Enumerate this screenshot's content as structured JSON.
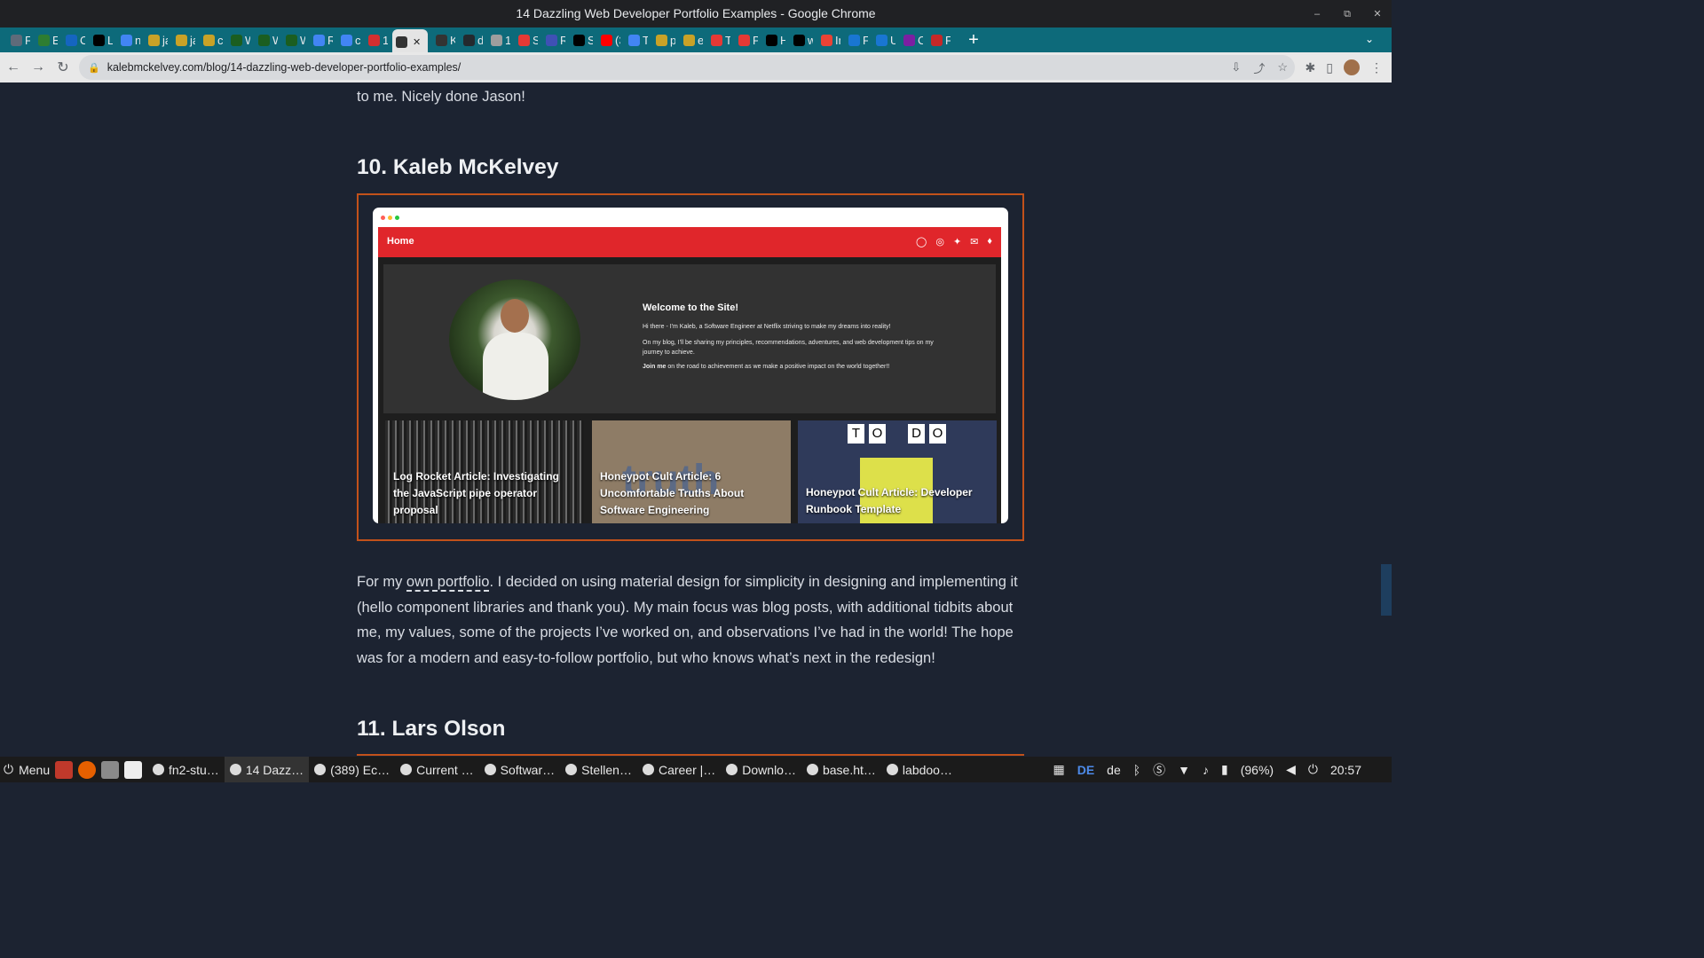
{
  "window": {
    "title": "14 Dazzling Web Developer Portfolio Examples - Google Chrome",
    "controls": [
      "–",
      "⧉",
      "✕"
    ]
  },
  "tabs": [
    {
      "label": "Fi",
      "fav_color": "#5f6b7a"
    },
    {
      "label": "Er",
      "fav_color": "#2e7d32"
    },
    {
      "label": "Cc",
      "fav_color": "#1565c0"
    },
    {
      "label": "Li",
      "fav_color": "#000000"
    },
    {
      "label": "na",
      "fav_color": "#4285f4"
    },
    {
      "label": "ja",
      "fav_color": "#c9a227"
    },
    {
      "label": "ja",
      "fav_color": "#c9a227"
    },
    {
      "label": "cs",
      "fav_color": "#c9a227"
    },
    {
      "label": "W",
      "fav_color": "#1b5e20"
    },
    {
      "label": "W",
      "fav_color": "#1b5e20"
    },
    {
      "label": "W",
      "fav_color": "#1b5e20"
    },
    {
      "label": "Re",
      "fav_color": "#4285f4"
    },
    {
      "label": "cr",
      "fav_color": "#4285f4"
    },
    {
      "label": "14",
      "fav_color": "#d32f2f"
    },
    {
      "label": "",
      "fav_color": "#333333",
      "active": true
    },
    {
      "label": "K:",
      "fav_color": "#333333"
    },
    {
      "label": "dj",
      "fav_color": "#24292e"
    },
    {
      "label": "12",
      "fav_color": "#9e9e9e"
    },
    {
      "label": "St",
      "fav_color": "#e53935"
    },
    {
      "label": "Re",
      "fav_color": "#3f51b5"
    },
    {
      "label": "Sc",
      "fav_color": "#000000"
    },
    {
      "label": "(3",
      "fav_color": "#ff0000"
    },
    {
      "label": "Tr",
      "fav_color": "#4285f4"
    },
    {
      "label": "py",
      "fav_color": "#c9a227"
    },
    {
      "label": "ec",
      "fav_color": "#c9a227"
    },
    {
      "label": "Tr",
      "fav_color": "#e53935"
    },
    {
      "label": "Py",
      "fav_color": "#e53935"
    },
    {
      "label": "H:",
      "fav_color": "#000000"
    },
    {
      "label": "w",
      "fav_color": "#000000"
    },
    {
      "label": "In",
      "fav_color": "#ea4335"
    },
    {
      "label": "Fr",
      "fav_color": "#1976d2"
    },
    {
      "label": "Ui",
      "fav_color": "#1976d2"
    },
    {
      "label": "Cc",
      "fav_color": "#7b1fa2"
    },
    {
      "label": "Fr",
      "fav_color": "#c62828"
    }
  ],
  "tab_strip": {
    "new_tab": "+",
    "menu": "⌄"
  },
  "toolbar": {
    "back": "←",
    "forward": "→",
    "reload": "↻",
    "url": "kalebmckelvey.com/blog/14-dazzling-web-developer-portfolio-examples/",
    "lock": "🔒",
    "actions": [
      "⇩",
      "⤴",
      "☆"
    ],
    "extensions": [
      "✱",
      "▯"
    ]
  },
  "article": {
    "intro_tail": "to me. Nicely done Jason!",
    "heading_10": "10. Kaleb McKelvey",
    "heading_11": "11. Lars Olson",
    "para_before_link": "For my ",
    "para_link": "own portfolio",
    "para_after_link": ". I decided on using material design for simplicity in designing and implementing it (hello component libraries and thank you). My main focus was blog posts, with additional tidbits about me, my values, some of the projects I’ve worked on, and observations I’ve had in the world! The hope was for a modern and easy-to-follow portfolio, but who knows what’s next in the redesign!"
  },
  "mockup": {
    "nav_home": "Home",
    "nav_icons": [
      "◯",
      "◎",
      "✦",
      "✉",
      "♦"
    ],
    "welcome_title": "Welcome to the Site!",
    "welcome_p1": "Hi there - I'm Kaleb, a Software Engineer at Netflix striving to make my dreams into reality!",
    "welcome_p2": "On my blog, I'll be sharing my principles, recommendations, adventures, and web development tips on my journey to achieve.",
    "welcome_p3_bold": "Join me",
    "welcome_p3_rest": " on the road to achievement as we make a positive impact on the world together!!",
    "cards": [
      "Log Rocket Article: Investigating the JavaScript pipe operator proposal",
      "Honeypot Cult Article: 6 Uncomfortable Truths About Software Engineering",
      "Honeypot Cult Article: Developer Runbook Template"
    ],
    "card3_letters": [
      "T",
      "O",
      "D",
      "O"
    ],
    "card2_overlay": "truth",
    "accent": "#e0262b"
  },
  "taskbar": {
    "menu": "Menu",
    "tasks": [
      {
        "label": "fn2-stu…"
      },
      {
        "label": "14 Dazz…",
        "active": true
      },
      {
        "label": "(389) Ec…"
      },
      {
        "label": "Current …"
      },
      {
        "label": "Softwar…"
      },
      {
        "label": "Stellen…"
      },
      {
        "label": "Career |…"
      },
      {
        "label": "Downlo…"
      },
      {
        "label": "base.ht…"
      },
      {
        "label": "labdoo…"
      }
    ],
    "lang": "DE",
    "lang2": "de",
    "battery": "(96%)",
    "time": "20:57"
  }
}
